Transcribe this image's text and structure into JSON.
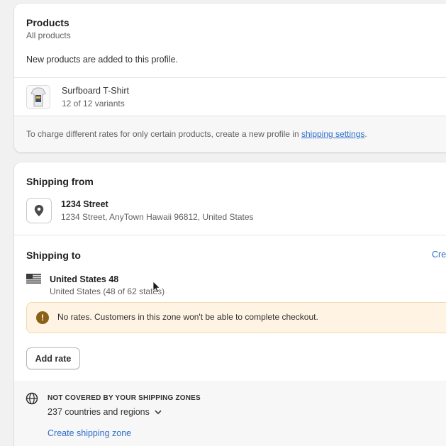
{
  "products": {
    "title": "Products",
    "subtitle": "All products",
    "note": "New products are added to this profile.",
    "item": {
      "name": "Surfboard T-Shirt",
      "variants": "12 of 12 variants",
      "icon": "product-thumbnail-icon"
    },
    "footer_text": "To charge different rates for only certain products, create a new profile in ",
    "footer_link": "shipping settings",
    "footer_end": "."
  },
  "shipping_from": {
    "title": "Shipping from",
    "location_name": "1234 Street",
    "address": "1234 Street, AnyTown Hawaii 96812, United States",
    "icon": "location-pin-icon"
  },
  "shipping_to": {
    "title": "Shipping to",
    "action_partial": "Cre",
    "zone_name": "United States 48",
    "zone_detail": "United States (48 of 62 states)",
    "flag_icon": "us-flag-icon",
    "warning": "No rates. Customers in this zone won't be able to complete checkout.",
    "warning_icon": "alert-icon",
    "add_rate": "Add rate"
  },
  "not_covered": {
    "heading": "NOT COVERED BY YOUR SHIPPING ZONES",
    "count": "237 countries and regions",
    "create_zone": "Create shipping zone",
    "icon": "globe-icon",
    "chevron": "chevron-down-icon"
  },
  "colors": {
    "link": "#2c6ecb",
    "warning_bg": "#fff4e4",
    "warning_icon": "#8a6116"
  }
}
